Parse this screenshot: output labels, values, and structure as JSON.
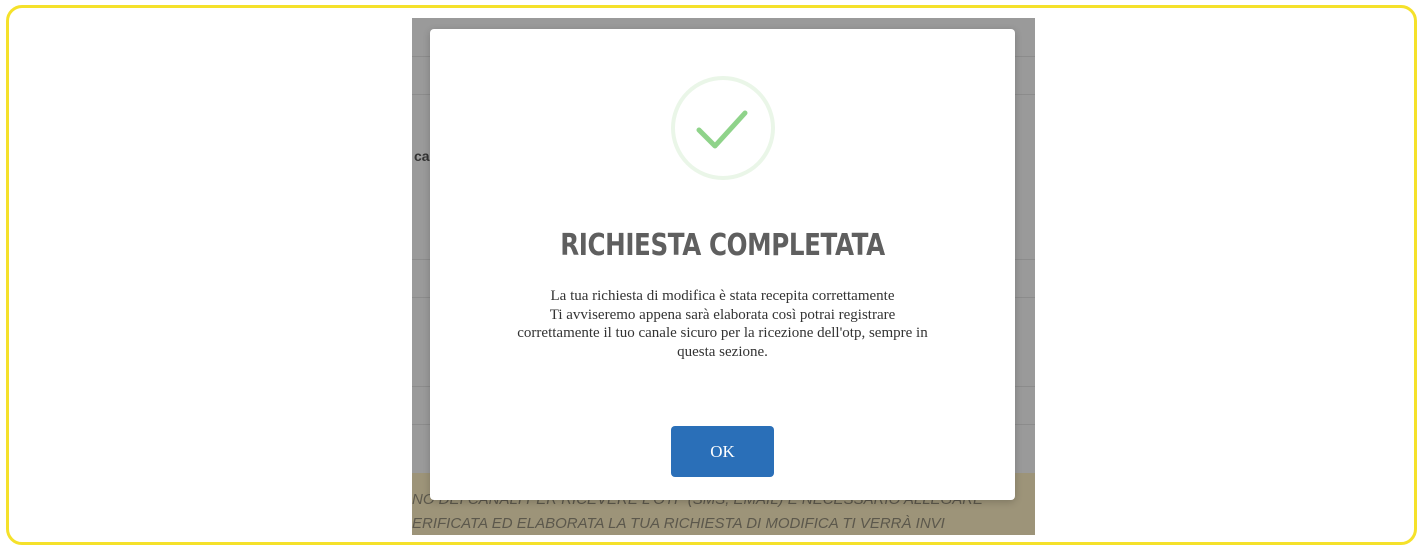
{
  "background": {
    "fragment_text": "caz",
    "notice_lines": [
      "NO DEI CANALI PER RICEVERE L'OTP (SMS, EMAIL) È NECESSARIO ALLEGARE",
      "ERIFICATA ED ELABORATA LA TUA RICHIESTA DI MODIFICA TI VERRÀ   INVI"
    ]
  },
  "modal": {
    "icon": "success-checkmark-icon",
    "title": "RICHIESTA COMPLETATA",
    "message_lines": [
      "La tua richiesta di modifica è stata recepita correttamente",
      "Ti avviseremo appena sarà elaborata così potrai registrare",
      "correttamente il tuo canale sicuro per la ricezione dell'otp, sempre in",
      "questa sezione."
    ],
    "ok_label": "OK"
  },
  "colors": {
    "frame_border": "#f5e12a",
    "backdrop": "#9a9a9a",
    "button": "#2a6fb8",
    "check": "#8fd38a",
    "title": "#5f5f5f"
  }
}
